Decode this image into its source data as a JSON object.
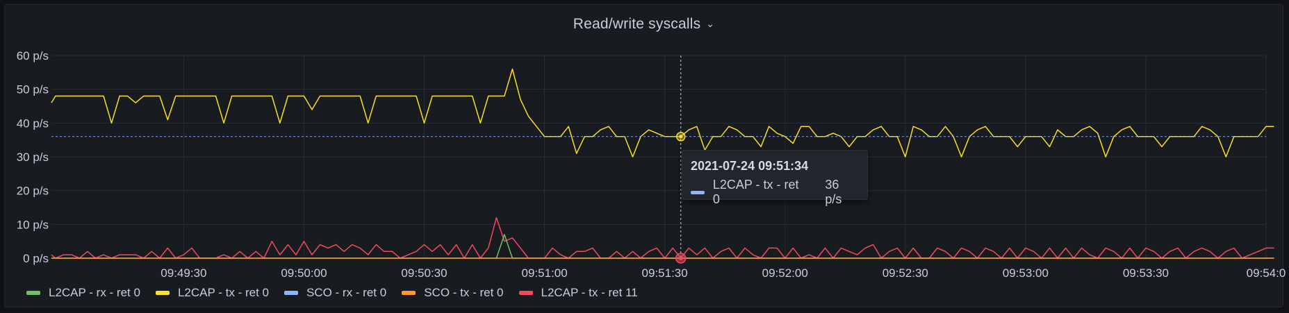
{
  "panel": {
    "title": "Read/write syscalls"
  },
  "tooltip": {
    "time": "2021-07-24 09:51:34",
    "series": "L2CAP - tx - ret 0",
    "value": "36 p/s",
    "swatch_color": "#8ab8ff"
  },
  "legend": [
    {
      "name": "L2CAP - rx - ret 0",
      "color": "#73bf69"
    },
    {
      "name": "L2CAP - tx - ret 0",
      "color": "#fade2a"
    },
    {
      "name": "SCO - rx - ret 0",
      "color": "#8ab8ff"
    },
    {
      "name": "SCO - tx - ret 0",
      "color": "#ff9830"
    },
    {
      "name": "L2CAP - tx - ret 11",
      "color": "#f2495c"
    }
  ],
  "chart_data": {
    "type": "line",
    "title": "Read/write syscalls",
    "ylim": [
      0,
      60
    ],
    "yticks": [
      0,
      10,
      20,
      30,
      40,
      50,
      60
    ],
    "ytick_labels": [
      "0 p/s",
      "10 p/s",
      "20 p/s",
      "30 p/s",
      "40 p/s",
      "50 p/s",
      "60 p/s"
    ],
    "xrange_seconds": [
      "09:48:57",
      "09:54:00"
    ],
    "xticks": [
      "09:49:30",
      "09:50:00",
      "09:50:30",
      "09:51:00",
      "09:51:30",
      "09:52:00",
      "09:52:30",
      "09:53:00",
      "09:53:30",
      "09:54:00"
    ],
    "xtick_labels": [
      "09:49:30",
      "09:50:00",
      "09:50:30",
      "09:51:00",
      "09:51:30",
      "09:52:00",
      "09:52:30",
      "09:53:00",
      "09:53:30",
      "09:54:0"
    ],
    "grid": true,
    "legend_position": "bottom-left",
    "crosshair": {
      "x": "09:51:34",
      "y": 36
    },
    "series": [
      {
        "name": "L2CAP - tx - ret 0",
        "color": "#fade2a",
        "points": [
          [
            "09:48:57",
            46
          ],
          [
            "09:48:58",
            48
          ],
          [
            "09:49:10",
            48
          ],
          [
            "09:49:12",
            40
          ],
          [
            "09:49:14",
            48
          ],
          [
            "09:49:16",
            48
          ],
          [
            "09:49:18",
            46
          ],
          [
            "09:49:20",
            48
          ],
          [
            "09:49:24",
            48
          ],
          [
            "09:49:26",
            41
          ],
          [
            "09:49:28",
            48
          ],
          [
            "09:49:38",
            48
          ],
          [
            "09:49:40",
            40
          ],
          [
            "09:49:42",
            48
          ],
          [
            "09:49:52",
            48
          ],
          [
            "09:49:54",
            40
          ],
          [
            "09:49:56",
            48
          ],
          [
            "09:50:00",
            48
          ],
          [
            "09:50:02",
            44
          ],
          [
            "09:50:04",
            48
          ],
          [
            "09:50:14",
            48
          ],
          [
            "09:50:16",
            40
          ],
          [
            "09:50:18",
            48
          ],
          [
            "09:50:28",
            48
          ],
          [
            "09:50:30",
            40
          ],
          [
            "09:50:32",
            48
          ],
          [
            "09:50:42",
            48
          ],
          [
            "09:50:44",
            40
          ],
          [
            "09:50:46",
            48
          ],
          [
            "09:50:50",
            48
          ],
          [
            "09:50:52",
            56
          ],
          [
            "09:50:54",
            47
          ],
          [
            "09:50:56",
            42
          ],
          [
            "09:51:00",
            36
          ],
          [
            "09:51:04",
            36
          ],
          [
            "09:51:06",
            39
          ],
          [
            "09:51:08",
            31
          ],
          [
            "09:51:10",
            36
          ],
          [
            "09:51:12",
            36
          ],
          [
            "09:51:14",
            38
          ],
          [
            "09:51:16",
            39
          ],
          [
            "09:51:18",
            36
          ],
          [
            "09:51:20",
            36
          ],
          [
            "09:51:22",
            30
          ],
          [
            "09:51:24",
            36
          ],
          [
            "09:51:26",
            38
          ],
          [
            "09:51:30",
            36
          ],
          [
            "09:51:34",
            36
          ],
          [
            "09:51:36",
            38
          ],
          [
            "09:51:38",
            39
          ],
          [
            "09:51:40",
            32
          ],
          [
            "09:51:42",
            36
          ],
          [
            "09:51:44",
            36
          ],
          [
            "09:51:46",
            39
          ],
          [
            "09:51:48",
            38
          ],
          [
            "09:51:50",
            36
          ],
          [
            "09:51:52",
            36
          ],
          [
            "09:51:54",
            33
          ],
          [
            "09:51:56",
            39
          ],
          [
            "09:51:58",
            37
          ],
          [
            "09:52:00",
            36
          ],
          [
            "09:52:02",
            34
          ],
          [
            "09:52:04",
            39
          ],
          [
            "09:52:06",
            39
          ],
          [
            "09:52:08",
            36
          ],
          [
            "09:52:10",
            36
          ],
          [
            "09:52:12",
            37
          ],
          [
            "09:52:14",
            36
          ],
          [
            "09:52:16",
            33
          ],
          [
            "09:52:18",
            36
          ],
          [
            "09:52:20",
            36
          ],
          [
            "09:52:22",
            38
          ],
          [
            "09:52:24",
            39
          ],
          [
            "09:52:26",
            36
          ],
          [
            "09:52:28",
            36
          ],
          [
            "09:52:30",
            30
          ],
          [
            "09:52:32",
            39
          ],
          [
            "09:52:34",
            38
          ],
          [
            "09:52:36",
            36
          ],
          [
            "09:52:38",
            36
          ],
          [
            "09:52:40",
            39
          ],
          [
            "09:52:42",
            36
          ],
          [
            "09:52:44",
            30
          ],
          [
            "09:52:46",
            36
          ],
          [
            "09:52:48",
            38
          ],
          [
            "09:52:50",
            39
          ],
          [
            "09:52:52",
            36
          ],
          [
            "09:52:54",
            36
          ],
          [
            "09:52:56",
            36
          ],
          [
            "09:52:58",
            33
          ],
          [
            "09:53:00",
            36
          ],
          [
            "09:53:02",
            36
          ],
          [
            "09:53:04",
            36
          ],
          [
            "09:53:06",
            33
          ],
          [
            "09:53:08",
            38
          ],
          [
            "09:53:10",
            36
          ],
          [
            "09:53:12",
            36
          ],
          [
            "09:53:14",
            38
          ],
          [
            "09:53:16",
            39
          ],
          [
            "09:53:18",
            37
          ],
          [
            "09:53:20",
            30
          ],
          [
            "09:53:22",
            36
          ],
          [
            "09:53:24",
            38
          ],
          [
            "09:53:26",
            39
          ],
          [
            "09:53:28",
            36
          ],
          [
            "09:53:32",
            36
          ],
          [
            "09:53:34",
            33
          ],
          [
            "09:53:36",
            36
          ],
          [
            "09:53:42",
            36
          ],
          [
            "09:53:44",
            39
          ],
          [
            "09:53:46",
            38
          ],
          [
            "09:53:48",
            36
          ],
          [
            "09:53:50",
            30
          ],
          [
            "09:53:52",
            36
          ],
          [
            "09:53:58",
            36
          ],
          [
            "09:54:00",
            39
          ],
          [
            "09:54:02",
            39
          ]
        ]
      },
      {
        "name": "L2CAP - tx - ret 11",
        "color": "#f2495c",
        "points": [
          [
            "09:48:57",
            1
          ],
          [
            "09:48:58",
            0
          ],
          [
            "09:49:00",
            1
          ],
          [
            "09:49:02",
            1
          ],
          [
            "09:49:04",
            0
          ],
          [
            "09:49:06",
            2
          ],
          [
            "09:49:08",
            0
          ],
          [
            "09:49:10",
            1
          ],
          [
            "09:49:12",
            0
          ],
          [
            "09:49:14",
            1
          ],
          [
            "09:49:16",
            1
          ],
          [
            "09:49:18",
            1
          ],
          [
            "09:49:20",
            0
          ],
          [
            "09:49:22",
            2
          ],
          [
            "09:49:24",
            0
          ],
          [
            "09:49:26",
            3
          ],
          [
            "09:49:28",
            0
          ],
          [
            "09:49:30",
            1
          ],
          [
            "09:49:32",
            3
          ],
          [
            "09:49:34",
            0
          ],
          [
            "09:49:38",
            0
          ],
          [
            "09:49:40",
            1
          ],
          [
            "09:49:42",
            0
          ],
          [
            "09:49:44",
            2
          ],
          [
            "09:49:46",
            0
          ],
          [
            "09:49:48",
            2
          ],
          [
            "09:49:50",
            0
          ],
          [
            "09:49:52",
            5
          ],
          [
            "09:49:54",
            1
          ],
          [
            "09:49:56",
            4
          ],
          [
            "09:49:58",
            1
          ],
          [
            "09:50:00",
            5
          ],
          [
            "09:50:02",
            1
          ],
          [
            "09:50:04",
            4
          ],
          [
            "09:50:06",
            3
          ],
          [
            "09:50:08",
            4
          ],
          [
            "09:50:10",
            2
          ],
          [
            "09:50:12",
            4
          ],
          [
            "09:50:14",
            3
          ],
          [
            "09:50:16",
            1
          ],
          [
            "09:50:18",
            4
          ],
          [
            "09:50:20",
            2
          ],
          [
            "09:50:22",
            2
          ],
          [
            "09:50:24",
            0
          ],
          [
            "09:50:26",
            1
          ],
          [
            "09:50:28",
            2
          ],
          [
            "09:50:30",
            4
          ],
          [
            "09:50:32",
            2
          ],
          [
            "09:50:34",
            4
          ],
          [
            "09:50:36",
            1
          ],
          [
            "09:50:38",
            4
          ],
          [
            "09:50:40",
            0
          ],
          [
            "09:50:42",
            4
          ],
          [
            "09:50:44",
            0
          ],
          [
            "09:50:46",
            3
          ],
          [
            "09:50:48",
            12
          ],
          [
            "09:50:50",
            5
          ],
          [
            "09:50:52",
            6
          ],
          [
            "09:50:54",
            3
          ],
          [
            "09:50:56",
            0
          ],
          [
            "09:51:00",
            0
          ],
          [
            "09:51:02",
            3
          ],
          [
            "09:51:04",
            1
          ],
          [
            "09:51:06",
            0
          ],
          [
            "09:51:08",
            2
          ],
          [
            "09:51:10",
            2
          ],
          [
            "09:51:12",
            3
          ],
          [
            "09:51:14",
            0
          ],
          [
            "09:51:16",
            0
          ],
          [
            "09:51:18",
            2
          ],
          [
            "09:51:20",
            0
          ],
          [
            "09:51:22",
            2
          ],
          [
            "09:51:24",
            0
          ],
          [
            "09:51:26",
            2
          ],
          [
            "09:51:28",
            3
          ],
          [
            "09:51:30",
            0
          ],
          [
            "09:51:32",
            3
          ],
          [
            "09:51:34",
            0
          ],
          [
            "09:51:36",
            3
          ],
          [
            "09:51:38",
            1
          ],
          [
            "09:51:40",
            3
          ],
          [
            "09:51:42",
            0
          ],
          [
            "09:51:44",
            2
          ],
          [
            "09:51:46",
            3
          ],
          [
            "09:51:48",
            0
          ],
          [
            "09:51:50",
            3
          ],
          [
            "09:51:52",
            1
          ],
          [
            "09:51:54",
            0
          ],
          [
            "09:51:56",
            3
          ],
          [
            "09:51:58",
            3
          ],
          [
            "09:52:00",
            0
          ],
          [
            "09:52:02",
            3
          ],
          [
            "09:52:04",
            0
          ],
          [
            "09:52:06",
            1
          ],
          [
            "09:52:08",
            0
          ],
          [
            "09:52:10",
            3
          ],
          [
            "09:52:12",
            0
          ],
          [
            "09:52:14",
            3
          ],
          [
            "09:52:16",
            2
          ],
          [
            "09:52:18",
            1
          ],
          [
            "09:52:20",
            3
          ],
          [
            "09:52:22",
            4
          ],
          [
            "09:52:24",
            0
          ],
          [
            "09:52:26",
            2
          ],
          [
            "09:52:28",
            3
          ],
          [
            "09:52:30",
            0
          ],
          [
            "09:52:32",
            3
          ],
          [
            "09:52:34",
            0
          ],
          [
            "09:52:36",
            0
          ],
          [
            "09:52:38",
            3
          ],
          [
            "09:52:40",
            2
          ],
          [
            "09:52:42",
            0
          ],
          [
            "09:52:44",
            3
          ],
          [
            "09:52:46",
            2
          ],
          [
            "09:52:48",
            0
          ],
          [
            "09:52:50",
            3
          ],
          [
            "09:52:52",
            2
          ],
          [
            "09:52:54",
            0
          ],
          [
            "09:52:56",
            3
          ],
          [
            "09:52:58",
            0
          ],
          [
            "09:53:00",
            3
          ],
          [
            "09:53:02",
            2
          ],
          [
            "09:53:04",
            0
          ],
          [
            "09:53:06",
            3
          ],
          [
            "09:53:08",
            0
          ],
          [
            "09:53:10",
            3
          ],
          [
            "09:53:12",
            0
          ],
          [
            "09:53:14",
            3
          ],
          [
            "09:53:16",
            1
          ],
          [
            "09:53:18",
            0
          ],
          [
            "09:53:20",
            3
          ],
          [
            "09:53:22",
            2
          ],
          [
            "09:53:24",
            0
          ],
          [
            "09:53:26",
            3
          ],
          [
            "09:53:28",
            0
          ],
          [
            "09:53:30",
            3
          ],
          [
            "09:53:32",
            2
          ],
          [
            "09:53:34",
            0
          ],
          [
            "09:53:36",
            2
          ],
          [
            "09:53:38",
            3
          ],
          [
            "09:53:40",
            0
          ],
          [
            "09:53:42",
            2
          ],
          [
            "09:53:44",
            3
          ],
          [
            "09:53:46",
            2
          ],
          [
            "09:53:48",
            0
          ],
          [
            "09:53:50",
            2
          ],
          [
            "09:53:52",
            3
          ],
          [
            "09:53:54",
            0
          ],
          [
            "09:53:58",
            2
          ],
          [
            "09:54:00",
            3
          ],
          [
            "09:54:02",
            3
          ]
        ]
      },
      {
        "name": "L2CAP - rx - ret 0",
        "color": "#73bf69",
        "points": [
          [
            "09:48:57",
            0
          ],
          [
            "09:50:48",
            0
          ],
          [
            "09:50:50",
            7
          ],
          [
            "09:50:52",
            0
          ],
          [
            "09:54:02",
            0
          ]
        ]
      },
      {
        "name": "SCO - tx - ret 0",
        "color": "#ff9830",
        "points": [
          [
            "09:48:57",
            0
          ],
          [
            "09:54:02",
            0
          ]
        ]
      }
    ]
  }
}
